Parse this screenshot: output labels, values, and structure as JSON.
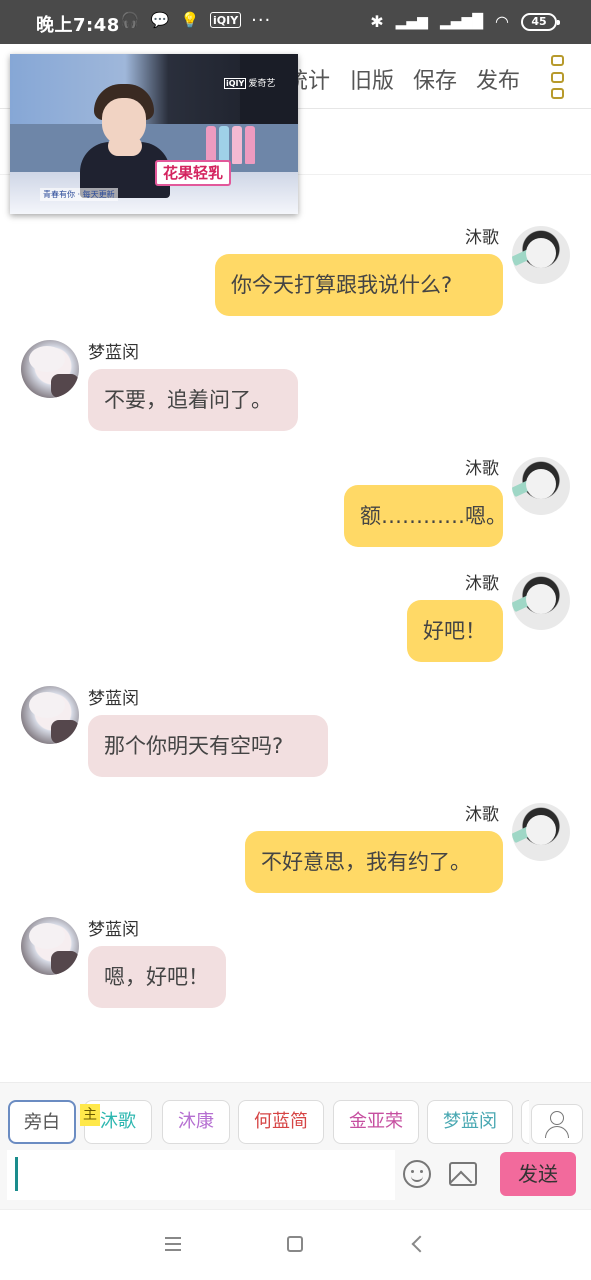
{
  "status_bar": {
    "time": "晚上7:48",
    "left_icons": [
      "headphones-icon",
      "wechat-icon",
      "bulb-icon",
      "iqiyi-icon",
      "more-dots-icon"
    ],
    "iqiyi_label": "iQIY",
    "dots": "···",
    "battery": "45",
    "right_icons": [
      "bluetooth-icon",
      "signal-icon",
      "signal-icon",
      "wifi-icon",
      "battery-icon"
    ]
  },
  "toolbar": {
    "items": [
      {
        "label": "统计"
      },
      {
        "label": "旧版"
      },
      {
        "label": "保存"
      },
      {
        "label": "发布"
      }
    ],
    "menu_icon": "menu-icon"
  },
  "video_overlay": {
    "brand": "爱奇艺",
    "brand_mark": "iQIY",
    "sign_text": "花果轻乳",
    "ticker": "青春有你 · 每天更新"
  },
  "messages": [
    {
      "side": "right",
      "sender": "沐歌",
      "text": "你今天打算跟我说什么?"
    },
    {
      "side": "left",
      "sender": "梦蓝闵",
      "text": "不要，追着问了。"
    },
    {
      "side": "right",
      "sender": "沐歌",
      "text": "额…………嗯。"
    },
    {
      "side": "right",
      "sender": "沐歌",
      "text": "好吧！"
    },
    {
      "side": "left",
      "sender": "梦蓝闵",
      "text": "那个你明天有空吗?"
    },
    {
      "side": "right",
      "sender": "沐歌",
      "text": "不好意思，我有约了。"
    },
    {
      "side": "left",
      "sender": "梦蓝闵",
      "text": "嗯，好吧！"
    }
  ],
  "characters": {
    "narration": "旁白",
    "crown": "主",
    "list": [
      {
        "name": "沐歌",
        "color": "#2db7b0"
      },
      {
        "name": "沐康",
        "color": "#b56fd1"
      },
      {
        "name": "何蓝简",
        "color": "#d64545"
      },
      {
        "name": "金亚荣",
        "color": "#c64fa0"
      },
      {
        "name": "梦蓝闵",
        "color": "#49a8b2"
      }
    ]
  },
  "input": {
    "value": "",
    "send_label": "发送"
  },
  "navbar": {
    "icons": [
      "nav-menu-icon",
      "nav-home-icon",
      "nav-back-icon"
    ]
  }
}
